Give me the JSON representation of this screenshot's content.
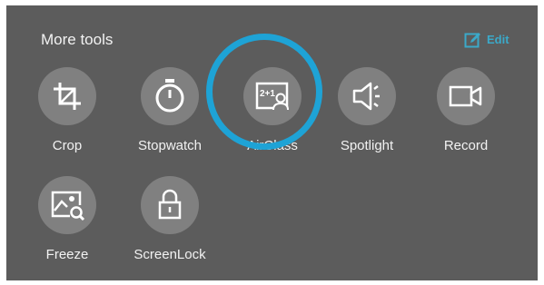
{
  "header": {
    "title": "More tools",
    "edit_label": "Edit"
  },
  "tools": [
    {
      "id": "crop",
      "label": "Crop",
      "icon": "crop-icon"
    },
    {
      "id": "stopwatch",
      "label": "Stopwatch",
      "icon": "stopwatch-icon"
    },
    {
      "id": "airclass",
      "label": "AirClass",
      "icon": "airclass-icon",
      "icon_text": "2+1"
    },
    {
      "id": "spotlight",
      "label": "Spotlight",
      "icon": "spotlight-icon"
    },
    {
      "id": "record",
      "label": "Record",
      "icon": "video-camera-icon"
    },
    {
      "id": "freeze",
      "label": "Freeze",
      "icon": "freeze-icon"
    },
    {
      "id": "screenlock",
      "label": "ScreenLock",
      "icon": "lock-icon"
    }
  ],
  "colors": {
    "panel_bg": "#5c5c5c",
    "icon_bg": "#808080",
    "accent": "#3ba9c9",
    "highlight": "#1ea3d6"
  }
}
